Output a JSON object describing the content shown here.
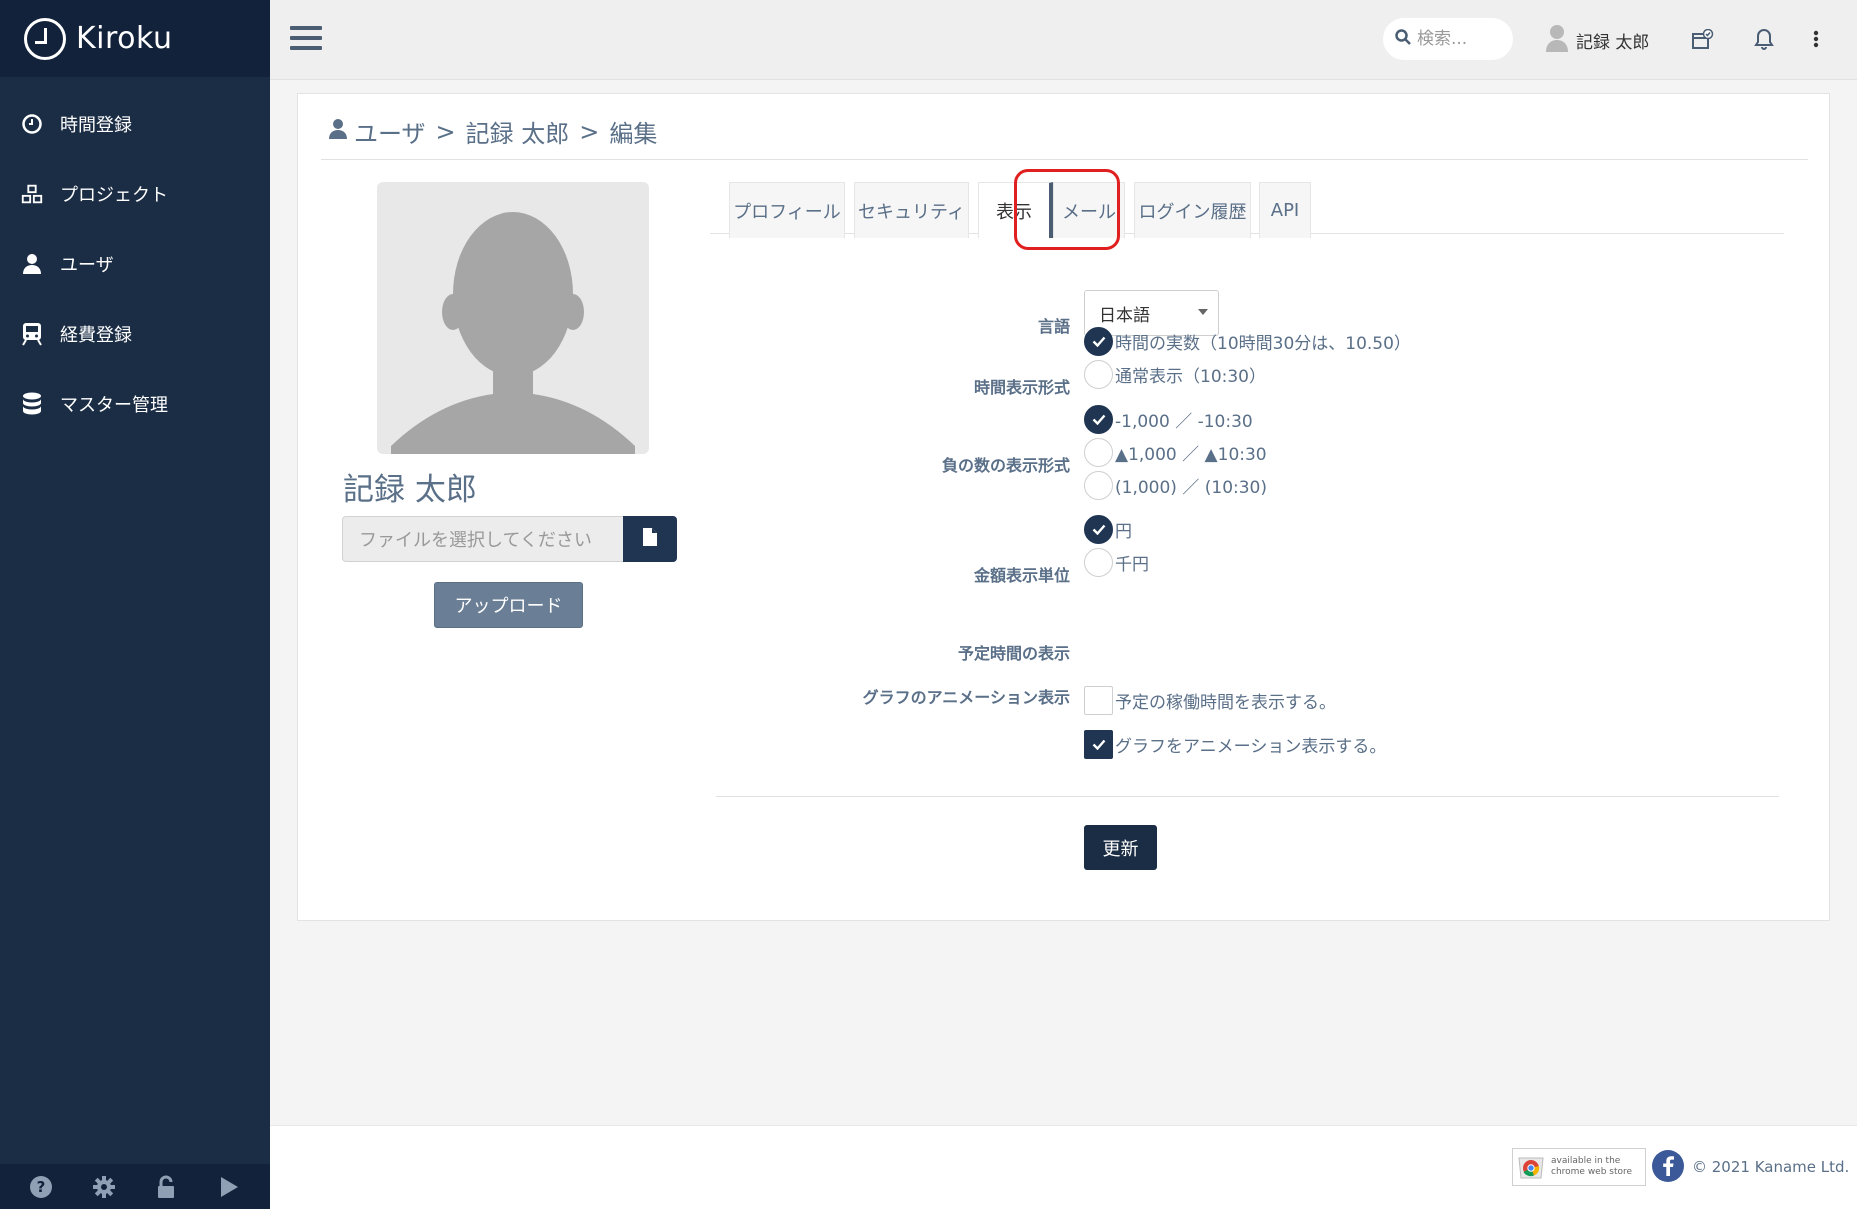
{
  "app": {
    "name": "Kiroku"
  },
  "sidebar": {
    "items": [
      {
        "label": "時間登録",
        "icon": "clock-icon"
      },
      {
        "label": "プロジェクト",
        "icon": "cubes-icon"
      },
      {
        "label": "ユーザ",
        "icon": "user-icon"
      },
      {
        "label": "経費登録",
        "icon": "train-icon"
      },
      {
        "label": "マスター管理",
        "icon": "database-icon"
      }
    ],
    "bottom_icons": [
      "help-icon",
      "gear-icon",
      "unlock-icon",
      "play-icon"
    ]
  },
  "header": {
    "search_placeholder": "検索...",
    "user_name": "記録 太郎"
  },
  "breadcrumb": {
    "root": "ユーザ",
    "separator": ">",
    "user": "記録 太郎",
    "current": "編集"
  },
  "profile": {
    "name": "記録 太郎",
    "file_placeholder": "ファイルを選択してください",
    "upload_label": "アップロード"
  },
  "tabs": [
    {
      "label": "プロフィール",
      "active": false
    },
    {
      "label": "セキュリティ",
      "active": false
    },
    {
      "label": "表示",
      "active": true
    },
    {
      "label": "メール",
      "active": false
    },
    {
      "label": "ログイン履歴",
      "active": false
    },
    {
      "label": "API",
      "active": false
    }
  ],
  "form": {
    "language": {
      "label": "言語",
      "value": "日本語"
    },
    "time_format": {
      "label": "時間表示形式",
      "options": [
        {
          "text": "時間の実数（10時間30分は、10.50）",
          "selected": true
        },
        {
          "text": "通常表示（10:30）",
          "selected": false
        }
      ]
    },
    "negative_format": {
      "label": "負の数の表示形式",
      "options": [
        {
          "text": "-1,000 ／ -10:30",
          "selected": true
        },
        {
          "text": "▲1,000 ／ ▲10:30",
          "selected": false
        },
        {
          "text": "(1,000) ／ (10:30)",
          "selected": false
        }
      ]
    },
    "currency_unit": {
      "label": "金額表示単位",
      "options": [
        {
          "text": "円",
          "selected": true
        },
        {
          "text": "千円",
          "selected": false
        }
      ]
    },
    "planned_time": {
      "label": "予定時間の表示",
      "text": "予定の稼働時間を表示する。",
      "checked": false
    },
    "graph_animation": {
      "label": "グラフのアニメーション表示",
      "text": "グラフをアニメーション表示する。",
      "checked": true
    },
    "save_label": "更新"
  },
  "footer": {
    "cws_line1": "available in the",
    "cws_line2": "chrome web store",
    "copyright": "© 2021 Kaname Ltd."
  },
  "colors": {
    "sidebar": "#1b2d45",
    "accent": "#1f3552",
    "highlight": "#e02020",
    "text_muted": "#5a6f88"
  }
}
